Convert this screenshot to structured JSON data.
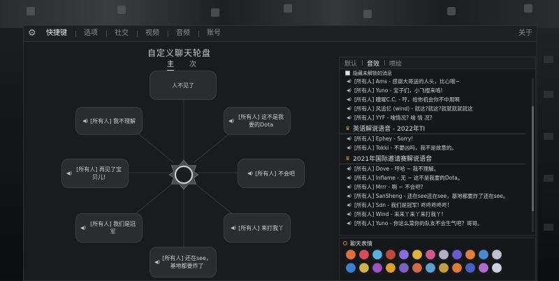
{
  "settings": {
    "tabs": [
      {
        "label": "快捷键",
        "active": true
      },
      {
        "label": "选项",
        "active": false
      },
      {
        "label": "社交",
        "active": false
      },
      {
        "label": "视频",
        "active": false
      },
      {
        "label": "音频",
        "active": false
      },
      {
        "label": "账号",
        "active": false
      }
    ],
    "close_label": "关于"
  },
  "wheel": {
    "title": "自定义聊天轮盘",
    "subtabs": [
      {
        "label": "主",
        "active": true
      },
      {
        "label": "次",
        "active": false
      }
    ],
    "slots": {
      "top": "人不见了",
      "top_left": "[所有人] 我不理解",
      "top_right": "[所有人] 这不是我要的Dota",
      "left": "[所有人] 再见了宝贝儿!",
      "right": "[所有人] 不会吧",
      "bottom_left": "[所有人] 我们是冠军",
      "bottom_right": "[所有人] 来打我丫",
      "bottom": "[所有人] 还在see，基地都要炸了"
    }
  },
  "chat": {
    "tabs": [
      {
        "label": "默认",
        "active": false
      },
      {
        "label": "音效",
        "active": true
      },
      {
        "label": "喷绘",
        "active": false
      }
    ],
    "hide_locked_label": "隐藏未解锁的消息",
    "rows_top": [
      "[所有人] Ams - 感谢大哥送的人头，比心哦~",
      "[所有人] Yuno - 宝子们，小飞棍来咯!",
      "[所有人] 瞳曜C.C. - 哼，给你机会你不中用啊",
      "[所有人] 风追忆 (wind) - 就这?就这?就就就就就这",
      "[所有人] YYF - 啥情况? 啥 情 况?"
    ],
    "group1": "英语解说语音 - 2022年TI",
    "rows_g1": [
      "[所有人] Ephey - Sorry!",
      "[所有人] Tokki - 不要凶吗，我不是故意的。"
    ],
    "group2": "2021年国际邀请赛解说语音",
    "rows_g2": [
      "[所有人] Dove - 哼哈 ~ 我不理解。",
      "[所有人] Inflame - 无 ~ 这不是我要的Dota。",
      "[所有人] Mrrr - 啊 ~ 不会吧?",
      "[所有人] SanSheng - 还在see还在see，基地都要炸了还在see。",
      "[所有人] Sdn - 我们是冠军! 咚咚咚咚咚!",
      "[所有人] Wind - 来来丫来丫来打我丫!",
      "[所有人] Yuno - 你这么菜你的队友不会生气吧？哥哥。"
    ]
  },
  "emotes": {
    "title": "聊天表情",
    "colors": [
      "#e0703a",
      "#d94a5a",
      "#5bb0e0",
      "#c04a3a",
      "#8a6ae0",
      "#e0b040",
      "#d05a8a",
      "#b0b0c0",
      "#6a5ad0",
      "#e08040",
      "#4a8ad0",
      "#c0c0d0",
      "#3a80d0",
      "#d0b050",
      "#a050c0",
      "#e0a030",
      "#7a60c0",
      "#d06a4a",
      "#5aa0d0",
      "#c0a040",
      "#e07a3a",
      "#4a60c0",
      "#b06ad0",
      "#d0d0e0"
    ]
  }
}
